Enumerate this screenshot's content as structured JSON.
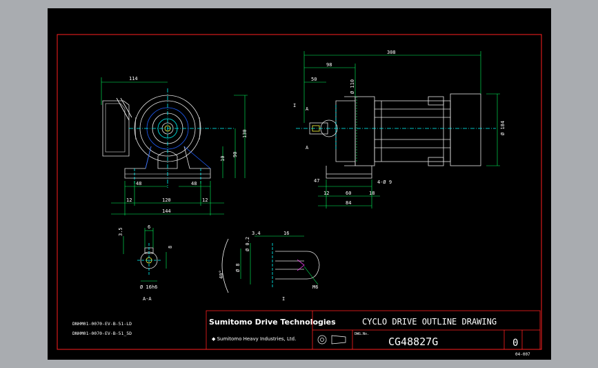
{
  "colors": {
    "frame": "#ff2020",
    "dim": "#ffffff",
    "part": "#e6e6e6",
    "center": "#00ffff",
    "hatch": "#2060ff",
    "accent": "#ffff40",
    "shaft": "#ff40ff"
  },
  "front_view": {
    "dims": [
      "114",
      "130",
      "90",
      "10",
      "48",
      "48",
      "12",
      "120",
      "12",
      "144"
    ]
  },
  "side_view": {
    "dims": [
      "308",
      "98",
      "50",
      "Ø 110",
      "Ø 184",
      "47",
      "12",
      "60",
      "18",
      "84",
      "4-Ø 9"
    ],
    "labels": [
      "I",
      "A",
      "A"
    ]
  },
  "section_aa": {
    "dims": [
      "3.5",
      "6",
      "8",
      "Ø 16h6"
    ],
    "title": "A-A"
  },
  "detail_i": {
    "dims": [
      "3.4",
      "16",
      "Ø 0.2",
      "Ø 8",
      "40°",
      "M6"
    ],
    "title": "I"
  },
  "notes": [
    "DNHM01-0070-EV-B-51-LD",
    "DNHM01-0070-EV-B-51_5D"
  ],
  "title_block": {
    "company": "Sumitomo Drive Technologies",
    "company_sub": "◆ Sumitomo Heavy Industries, Ltd.",
    "title": "CYCLO DRIVE OUTLINE DRAWING",
    "dwg_no_label": "DWG.No.",
    "dwg_no": "CG48827G",
    "rev": "0",
    "sheet_ref": "04-007"
  }
}
